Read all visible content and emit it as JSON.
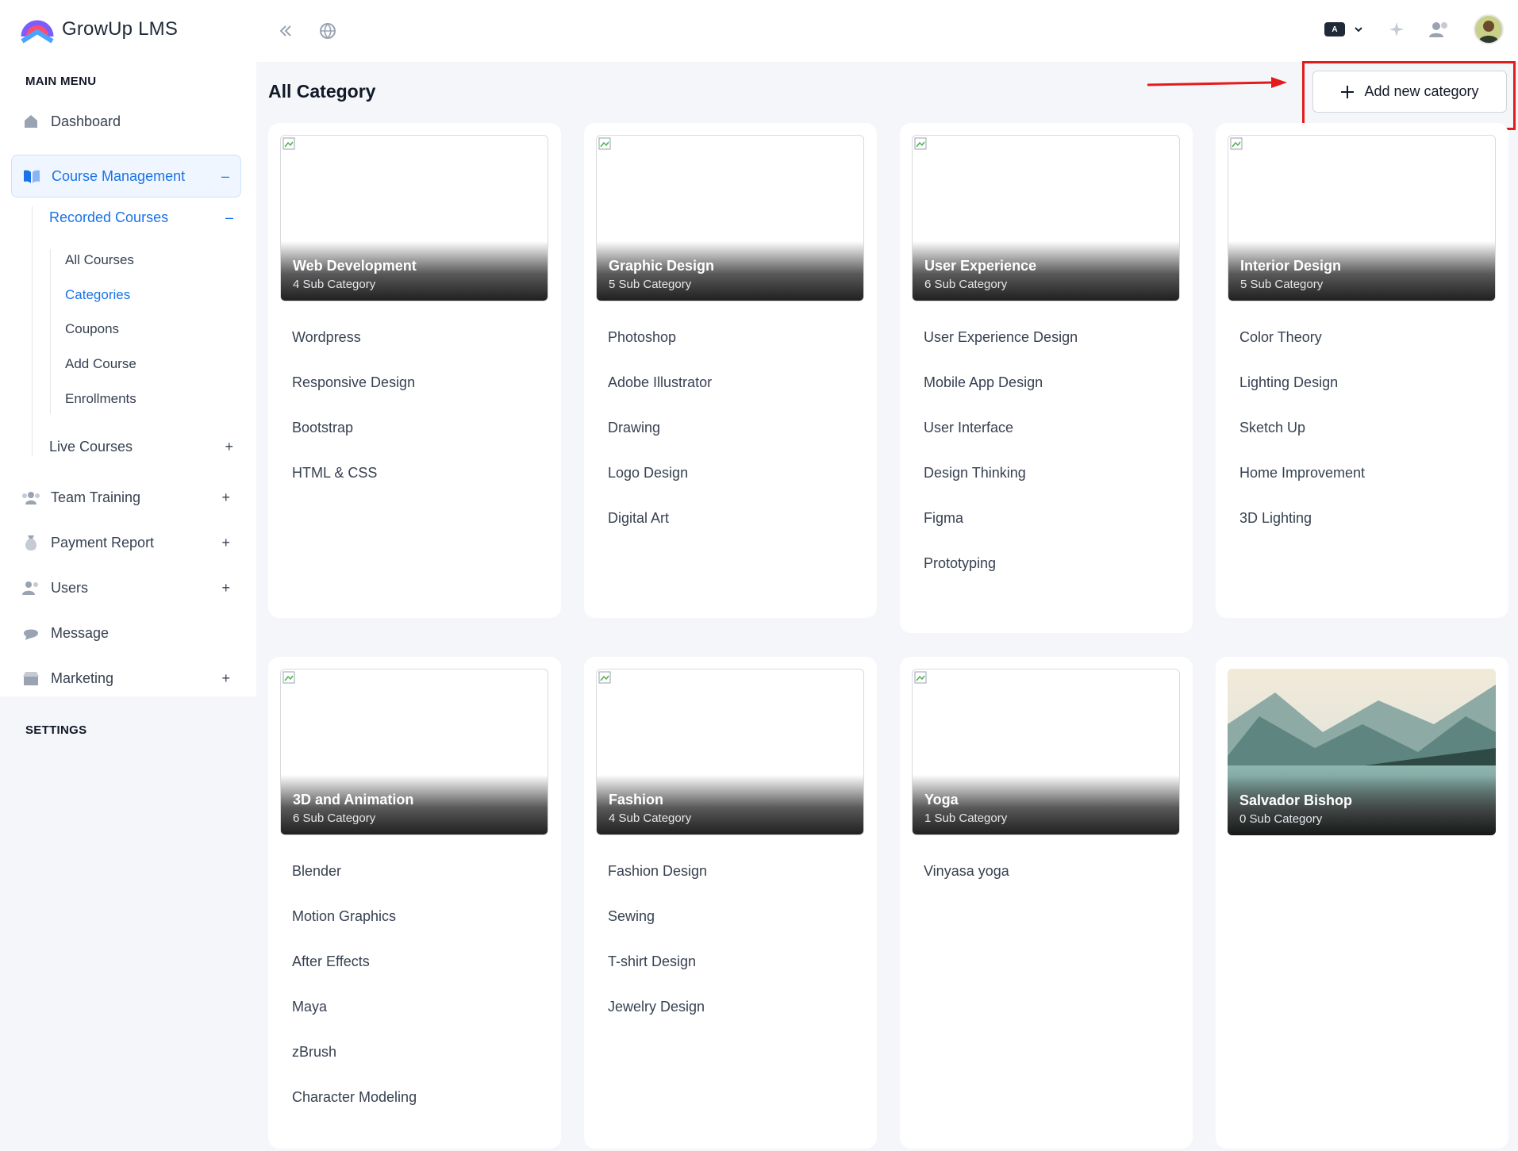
{
  "app": {
    "name": "GrowUp LMS"
  },
  "header": {
    "language_badge": "A",
    "icons": [
      "collapse-icon",
      "globe-icon",
      "sparkle-icon",
      "users-icon"
    ]
  },
  "sidebar": {
    "main_menu_title": "MAIN MENU",
    "settings_title": "SETTINGS",
    "items": [
      {
        "label": "Dashboard",
        "icon": "home-icon"
      },
      {
        "label": "Course Management",
        "icon": "book-icon",
        "sign": "–"
      },
      {
        "label": "Team Training",
        "icon": "team-icon",
        "sign": "+"
      },
      {
        "label": "Payment Report",
        "icon": "money-bag-icon",
        "sign": "+"
      },
      {
        "label": "Users",
        "icon": "users-icon",
        "sign": "+"
      },
      {
        "label": "Message",
        "icon": "message-icon"
      },
      {
        "label": "Marketing",
        "icon": "shop-icon",
        "sign": "+"
      }
    ],
    "recorded_courses": {
      "label": "Recorded Courses",
      "sign": "–"
    },
    "recorded_children": [
      "All Courses",
      "Categories",
      "Coupons",
      "Add Course",
      "Enrollments"
    ],
    "live_courses": {
      "label": "Live Courses",
      "sign": "+"
    }
  },
  "main": {
    "title": "All Category",
    "add_button": "Add new category",
    "categories": [
      {
        "name": "Web Development",
        "count": "4 Sub Category",
        "subs": [
          "Wordpress",
          "Responsive Design",
          "Bootstrap",
          "HTML & CSS"
        ]
      },
      {
        "name": "Graphic Design",
        "count": "5 Sub Category",
        "subs": [
          "Photoshop",
          "Adobe Illustrator",
          "Drawing",
          "Logo Design",
          "Digital Art"
        ]
      },
      {
        "name": "User Experience",
        "count": "6 Sub Category",
        "subs": [
          "User Experience Design",
          "Mobile App Design",
          "User Interface",
          "Design Thinking",
          "Figma",
          "Prototyping"
        ]
      },
      {
        "name": "Interior Design",
        "count": "5 Sub Category",
        "subs": [
          "Color Theory",
          "Lighting Design",
          "Sketch Up",
          "Home Improvement",
          "3D Lighting"
        ]
      },
      {
        "name": "3D and Animation",
        "count": "6 Sub Category",
        "subs": [
          "Blender",
          "Motion Graphics",
          "After Effects",
          "Maya",
          "zBrush",
          "Character Modeling"
        ]
      },
      {
        "name": "Fashion",
        "count": "4 Sub Category",
        "subs": [
          "Fashion Design",
          "Sewing",
          "T-shirt Design",
          "Jewelry Design"
        ]
      },
      {
        "name": "Yoga",
        "count": "1 Sub Category",
        "subs": [
          "Vinyasa yoga"
        ]
      },
      {
        "name": "Salvador Bishop",
        "count": "0 Sub Category",
        "subs": []
      }
    ]
  },
  "colors": {
    "accent": "#1a73e8",
    "annotation": "#e31b1b"
  }
}
